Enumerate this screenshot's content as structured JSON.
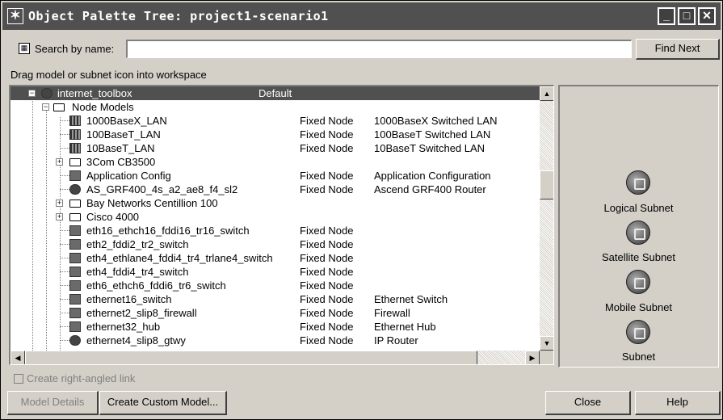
{
  "window": {
    "title": "Object Palette Tree: project1-scenario1",
    "icon": "star-icon"
  },
  "search": {
    "label_pre": "Search by name:",
    "value": "",
    "find_button": "Find Next"
  },
  "hint": "Drag model or subnet icon into workspace",
  "tree": {
    "root": {
      "name": "internet_toolbox",
      "default": "Default"
    },
    "folder": "Node Models",
    "rows": [
      {
        "name": "1000BaseX_LAN",
        "type": "Fixed Node",
        "desc": "1000BaseX Switched LAN",
        "icon": "lan-icon"
      },
      {
        "name": "100BaseT_LAN",
        "type": "Fixed Node",
        "desc": "100BaseT Switched LAN",
        "icon": "lan-icon"
      },
      {
        "name": "10BaseT_LAN",
        "type": "Fixed Node",
        "desc": "10BaseT Switched LAN",
        "icon": "lan-icon"
      },
      {
        "name": "3Com CB3500",
        "type": "",
        "desc": "",
        "icon": "folder-icon"
      },
      {
        "name": "Application Config",
        "type": "Fixed Node",
        "desc": "Application Configuration",
        "icon": "config-icon"
      },
      {
        "name": "AS_GRF400_4s_a2_ae8_f4_sl2",
        "type": "Fixed Node",
        "desc": "Ascend GRF400 Router",
        "icon": "router-icon"
      },
      {
        "name": "Bay Networks Centillion 100",
        "type": "",
        "desc": "",
        "icon": "folder-icon"
      },
      {
        "name": "Cisco 4000",
        "type": "",
        "desc": "",
        "icon": "folder-icon"
      },
      {
        "name": "eth16_ethch16_fddi16_tr16_switch",
        "type": "Fixed Node",
        "desc": "",
        "icon": "switch-icon"
      },
      {
        "name": "eth2_fddi2_tr2_switch",
        "type": "Fixed Node",
        "desc": "",
        "icon": "switch-icon"
      },
      {
        "name": "eth4_ethlane4_fddi4_tr4_trlane4_switch",
        "type": "Fixed Node",
        "desc": "",
        "icon": "switch-icon"
      },
      {
        "name": "eth4_fddi4_tr4_switch",
        "type": "Fixed Node",
        "desc": "",
        "icon": "switch-icon"
      },
      {
        "name": "eth6_ethch6_fddi6_tr6_switch",
        "type": "Fixed Node",
        "desc": "",
        "icon": "switch-icon"
      },
      {
        "name": "ethernet16_switch",
        "type": "Fixed Node",
        "desc": "Ethernet Switch",
        "icon": "switch-icon"
      },
      {
        "name": "ethernet2_slip8_firewall",
        "type": "Fixed Node",
        "desc": "Firewall",
        "icon": "firewall-icon"
      },
      {
        "name": "ethernet32_hub",
        "type": "Fixed Node",
        "desc": "Ethernet Hub",
        "icon": "hub-icon"
      },
      {
        "name": "ethernet4_slip8_gtwy",
        "type": "Fixed Node",
        "desc": "IP Router",
        "icon": "router-icon"
      }
    ]
  },
  "subnets": [
    {
      "label": "Logical Subnet",
      "icon": "logical-subnet-icon"
    },
    {
      "label": "Satellite Subnet",
      "icon": "satellite-subnet-icon"
    },
    {
      "label": "Mobile Subnet",
      "icon": "mobile-subnet-icon"
    },
    {
      "label": "Subnet",
      "icon": "subnet-icon"
    }
  ],
  "bottom": {
    "checkbox_label": "Create right-angled link",
    "model_details": "Model Details",
    "create_custom_model": "Create Custom Model...",
    "close": "Close",
    "help": "Help"
  }
}
